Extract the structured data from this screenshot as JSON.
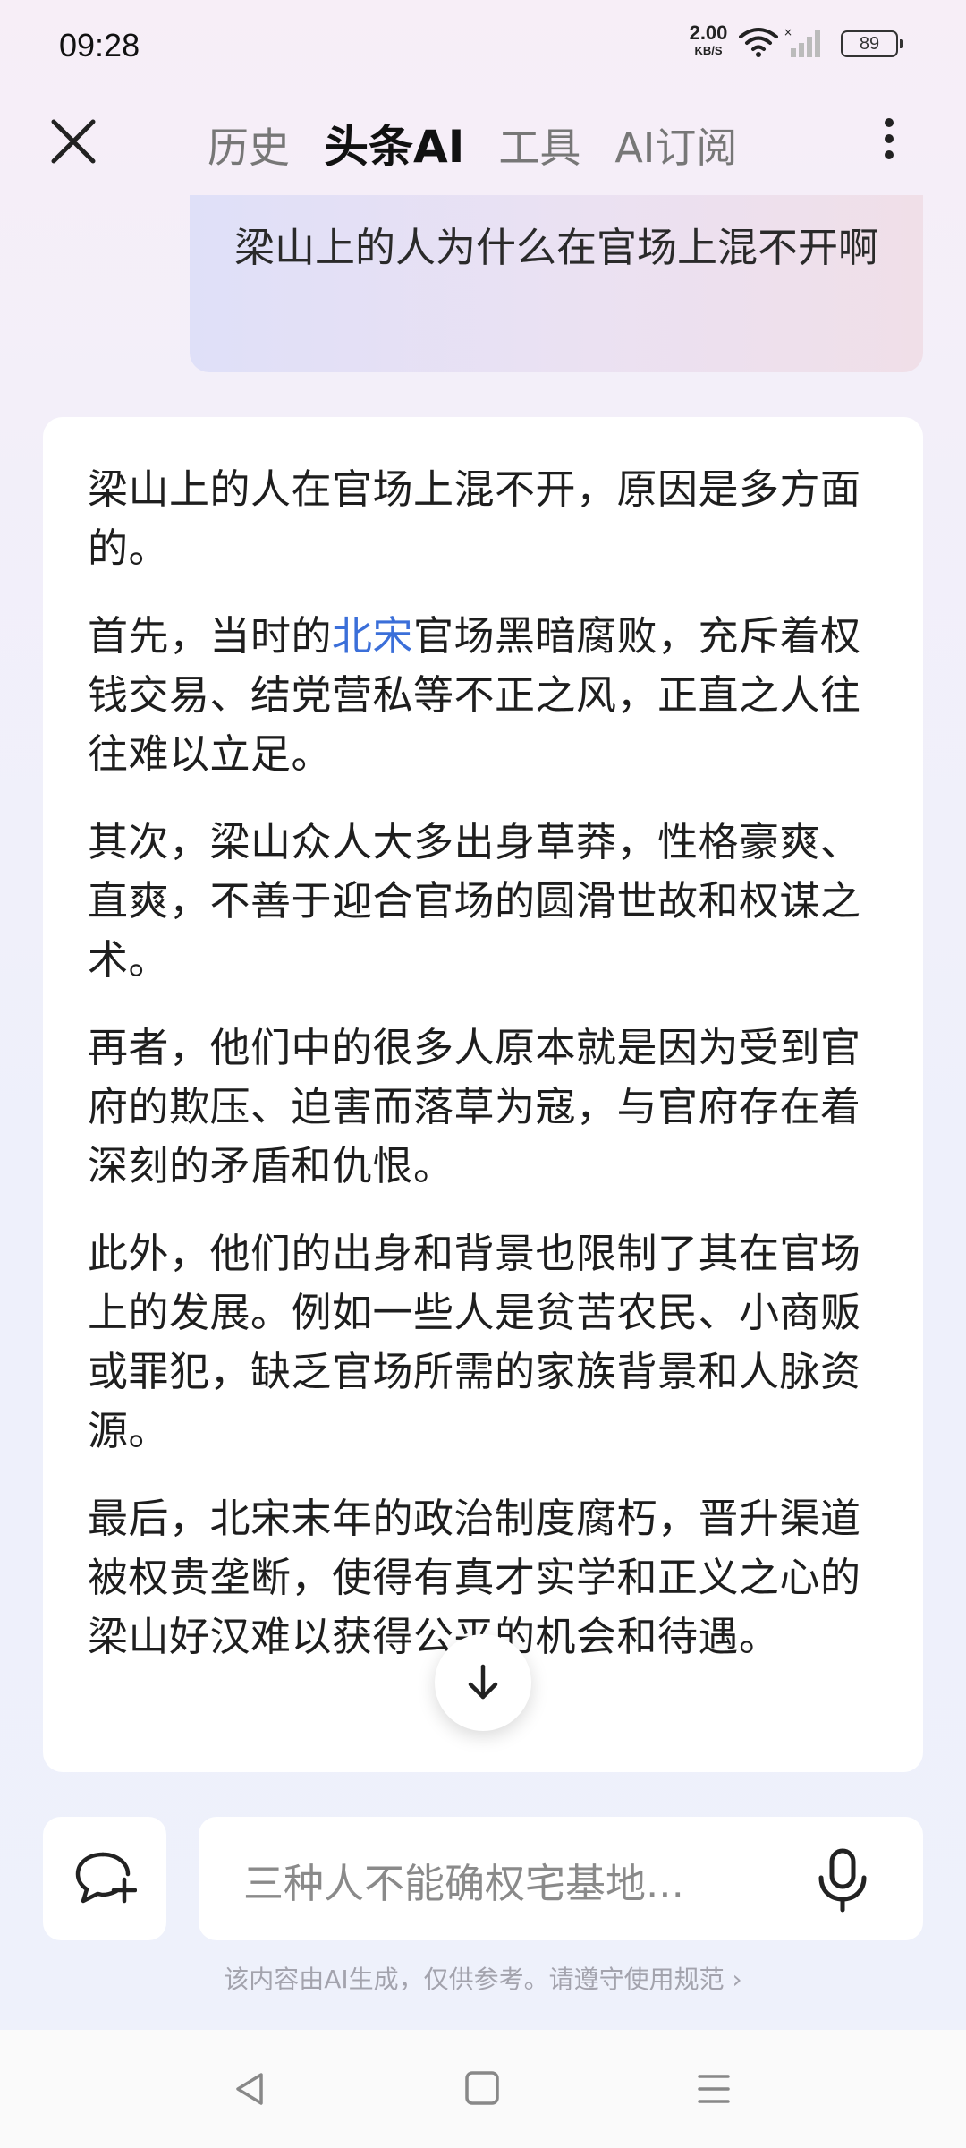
{
  "status_bar": {
    "time": "09:28",
    "net_speed_value": "2.00",
    "net_speed_unit": "KB/S",
    "battery": "89",
    "icons": [
      "wifi-icon",
      "signal-icon",
      "battery-icon"
    ]
  },
  "nav": {
    "tabs": [
      {
        "label": "历史",
        "active": false
      },
      {
        "label": "头条AI",
        "active": true
      },
      {
        "label": "工具",
        "active": false
      },
      {
        "label": "AI订阅",
        "active": false
      }
    ],
    "icons": {
      "close": "close-icon",
      "more": "more-vertical-icon"
    }
  },
  "question": "梁山上的人为什么在官场上混不开啊",
  "answer": {
    "p1": "梁山上的人在官场上混不开，原因是多方面的。",
    "p2_before": "首先，当时的",
    "p2_link": "北宋",
    "p2_after": "官场黑暗腐败，充斥着权钱交易、结党营私等不正之风，正直之人往往难以立足。",
    "p3": "其次，梁山众人大多出身草莽，性格豪爽、直爽，不善于迎合官场的圆滑世故和权谋之术。",
    "p4": "再者，他们中的很多人原本就是因为受到官府的欺压、迫害而落草为寇，与官府存在着深刻的矛盾和仇恨。",
    "p5": "此外，他们的出身和背景也限制了其在官场上的发展。例如一些人是贫苦农民、小商贩或罪犯，缺乏官场所需的家族背景和人脉资源。",
    "p6": "最后，北宋末年的政治制度腐朽，晋升渠道被权贵垄断，使得有真才实学和正义之心的梁山好汉难以获得公平的机会和待遇。"
  },
  "input": {
    "placeholder": "三种人不能确权宅基地..."
  },
  "disclaimer": "该内容由AI生成，仅供参考。请遵守使用规范 ›",
  "colors": {
    "link": "#3b6fd9",
    "bubble_start": "#dfe0f8",
    "bubble_end": "#f0dfe8"
  }
}
